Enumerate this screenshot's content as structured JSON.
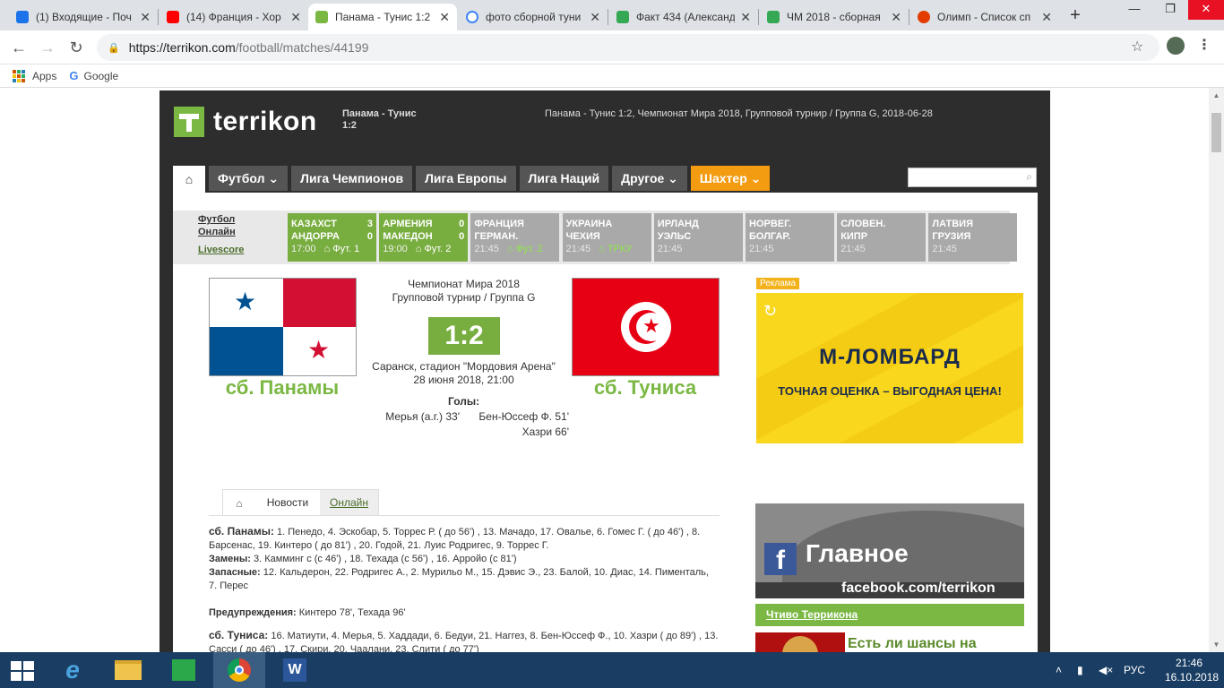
{
  "browser": {
    "tabs": [
      {
        "title": "(1) Входящие - Поч",
        "icon": "mail-icon",
        "color": "#1a73e8"
      },
      {
        "title": "(14) Франция - Хор",
        "icon": "youtube-icon",
        "color": "#ff0000"
      },
      {
        "title": "Панама - Тунис 1:2",
        "icon": "terrikon-icon",
        "color": "#7ab843"
      },
      {
        "title": "фото сборной туни",
        "icon": "google-icon",
        "color": "#4285f4"
      },
      {
        "title": "Факт 434 (Александ",
        "icon": "sheets-icon",
        "color": "#34a853"
      },
      {
        "title": "ЧМ 2018 - сборная",
        "icon": "sheets-icon",
        "color": "#34a853"
      },
      {
        "title": "Олимп - Список сп",
        "icon": "olimp-icon",
        "color": "#e33b00"
      }
    ],
    "active_tab": 2,
    "url_host": "https://terrikon.com",
    "url_path": "/football/matches/44199",
    "bookmarks": [
      "Apps",
      "Google"
    ]
  },
  "site": {
    "logo": "terrikon",
    "header_match": "Панама - Тунис 1:2",
    "header_info": "Панама - Тунис 1:2, Чемпионат Мира 2018, Групповой турнир / Группа G, 2018-06-28",
    "nav": [
      "Футбол",
      "Лига Чемпионов",
      "Лига Европы",
      "Лига Наций",
      "Другое",
      "Шахтер"
    ],
    "nav_dropdown": [
      true,
      false,
      false,
      false,
      true,
      true
    ],
    "search_placeholder": ""
  },
  "livescore": {
    "links": [
      "Футбол Онлайн",
      "Livescore"
    ],
    "matches": [
      {
        "home": "КАЗАХСТ",
        "away": "АНДОРРА",
        "hs": "3",
        "as": "0",
        "time": "17:00",
        "channel": "Фут. 1",
        "live": true
      },
      {
        "home": "АРМЕНИЯ",
        "away": "МАКЕДОН",
        "hs": "0",
        "as": "0",
        "time": "19:00",
        "channel": "Фут. 2",
        "live": true
      },
      {
        "home": "ФРАНЦИЯ",
        "away": "ГЕРМАН.",
        "hs": "",
        "as": "",
        "time": "21:45",
        "channel": "Фут. 2",
        "live": false
      },
      {
        "home": "УКРАИНА",
        "away": "ЧЕХИЯ",
        "hs": "",
        "as": "",
        "time": "21:45",
        "channel": "ТРКУ",
        "live": false
      },
      {
        "home": "ИРЛАНД",
        "away": "УЭЛЬС",
        "hs": "",
        "as": "",
        "time": "21:45",
        "channel": "",
        "live": false
      },
      {
        "home": "НОРВЕГ.",
        "away": "БОЛГАР.",
        "hs": "",
        "as": "",
        "time": "21:45",
        "channel": "",
        "live": false
      },
      {
        "home": "СЛОВЕН.",
        "away": "КИПР",
        "hs": "",
        "as": "",
        "time": "21:45",
        "channel": "",
        "live": false
      },
      {
        "home": "ЛАТВИЯ",
        "away": "ГРУЗИЯ",
        "hs": "",
        "as": "",
        "time": "21:45",
        "channel": "",
        "live": false
      }
    ]
  },
  "match": {
    "tournament": "Чемпионат Мира 2018",
    "stage": "Групповой турнир / Группа G",
    "score": "1:2",
    "home": "сб. Панамы",
    "away": "сб. Туниса",
    "venue": "Саранск, стадион \"Мордовия Арена\"",
    "datetime": "28 июня 2018, 21:00",
    "goals_label": "Голы:",
    "home_goals": [
      "Мерья (а.г.) 33'"
    ],
    "away_goals": [
      "Бен-Юссеф Ф. 51'",
      "Хазри 66'"
    ]
  },
  "tabs": {
    "news": "Новости",
    "online": "Онлайн"
  },
  "lineups": {
    "home_title": "сб. Панамы:",
    "home_text": "1. Пенедо, 4. Эскобар, 5. Торрес Р. ( до 56') , 13. Мачадо, 17. Овалье, 6. Гомес Г. ( до 46') , 8. Барсенас, 19. Кинтеро ( до 81') , 20. Годой, 21. Луис Родригес, 9. Торрес Г.",
    "subs_label": "Замены:",
    "subs_text": "3. Камминг с (с 46') , 18. Техада (с 56') , 16. Арройо (с 81')",
    "bench_label": "Запасные:",
    "bench_text": "12. Кальдерон, 22. Родригес А., 2. Мурильо М., 15. Дэвис Э., 23. Балой, 10. Диас, 14. Пименталь, 7. Перес",
    "warn_label": "Предупреждения:",
    "warn_text": "Кинтеро 78', Техада 96'",
    "away_title": "сб. Туниса:",
    "away_text": "16. Матиути, 4. Мерья, 5. Хаддади, 6. Бедуи, 21. Наггез, 8. Бен-Юссеф Ф., 10. Хазри ( до 89') , 13. Сасси ( до 46') , 17. Скири, 20. Чаалани, 23. Слити ( до 77')"
  },
  "sidebar": {
    "ad_label": "Реклама",
    "ad_brand": "М-ЛОМБАРД",
    "ad_slogan": "ТОЧНАЯ ОЦЕНКА – ВЫГОДНАЯ ЦЕНА!",
    "fb_title": "Главное",
    "fb_url": "facebook.com/terrikon",
    "chtivo": "Чтиво Терриконa",
    "article_title": "Есть ли шансы на"
  },
  "taskbar": {
    "lang": "РУС",
    "time": "21:46",
    "date": "16.10.2018"
  }
}
